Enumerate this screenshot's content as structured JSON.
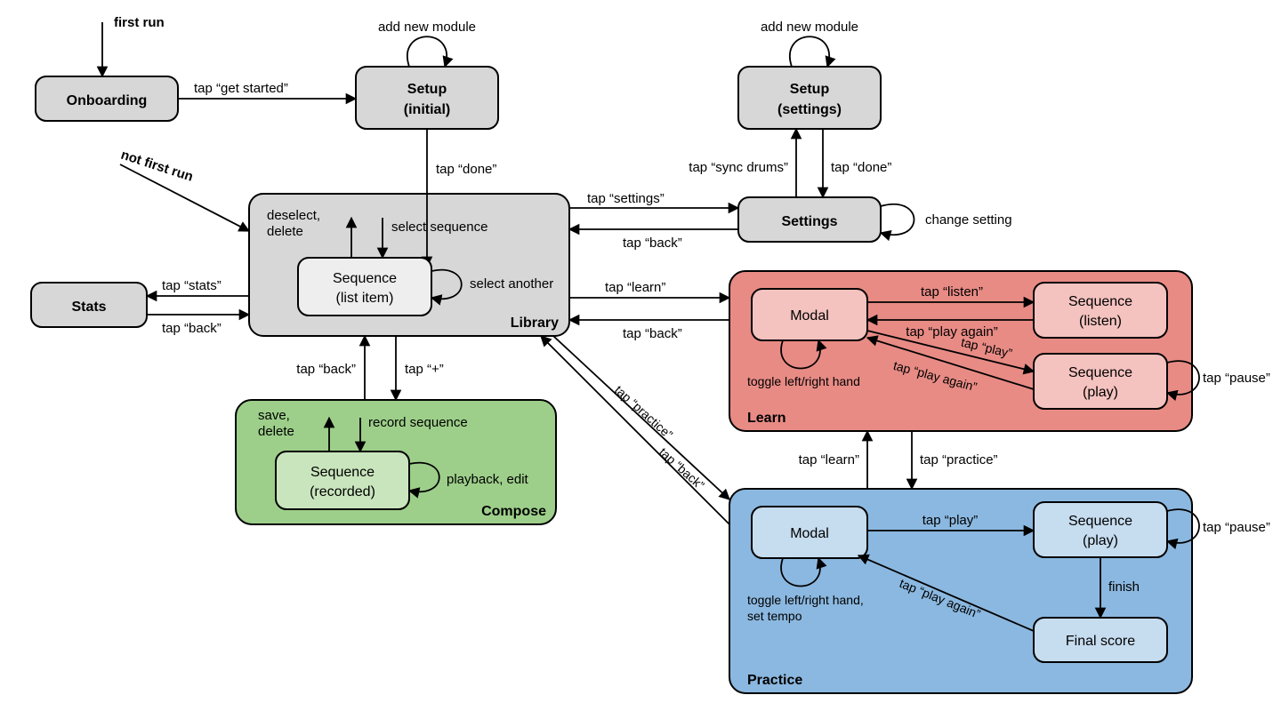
{
  "nodes": {
    "onboarding": "Onboarding",
    "setup_initial_l1": "Setup",
    "setup_initial_l2": "(initial)",
    "setup_settings_l1": "Setup",
    "setup_settings_l2": "(settings)",
    "settings": "Settings",
    "stats": "Stats",
    "library": "Library",
    "sequence_list_l1": "Sequence",
    "sequence_list_l2": "(list item)",
    "compose": "Compose",
    "sequence_rec_l1": "Sequence",
    "sequence_rec_l2": "(recorded)",
    "learn": "Learn",
    "learn_modal": "Modal",
    "learn_seq_listen_l1": "Sequence",
    "learn_seq_listen_l2": "(listen)",
    "learn_seq_play_l1": "Sequence",
    "learn_seq_play_l2": "(play)",
    "practice": "Practice",
    "practice_modal": "Modal",
    "practice_seq_play_l1": "Sequence",
    "practice_seq_play_l2": "(play)",
    "final_score": "Final score"
  },
  "edges": {
    "first_run": "first run",
    "not_first_run": "not first run",
    "tap_get_started": "tap “get started”",
    "add_new_module_1": "add new module",
    "add_new_module_2": "add new module",
    "tap_done_1": "tap “done”",
    "tap_done_2": "tap “done”",
    "tap_sync_drums": "tap “sync drums”",
    "tap_settings": "tap “settings”",
    "tap_back_settings": "tap “back”",
    "change_setting": "change setting",
    "deselect_delete": "deselect,\ndelete",
    "select_sequence": "select sequence",
    "select_another": "select another",
    "tap_stats": "tap “stats”",
    "tap_back_stats": "tap “back”",
    "tap_back_compose": "tap “back”",
    "tap_plus": "tap “+”",
    "save_delete": "save,\ndelete",
    "record_sequence": "record sequence",
    "playback_edit": "playback, edit",
    "tap_learn": "tap “learn”",
    "tap_back_learn": "tap “back”",
    "tap_practice": "tap “practice”",
    "tap_back_practice": "tap “back”",
    "tap_listen": "tap “listen”",
    "tap_play_again_listen": "tap “play again”",
    "tap_play_learn": "tap “play”",
    "tap_play_again_play": "tap “play again”",
    "tap_pause_learn": "tap “pause”",
    "toggle_hand": "toggle left/right hand",
    "tap_learn_2": "tap “learn”",
    "tap_practice_2": "tap “practice”",
    "tap_play_practice": "tap “play”",
    "finish": "finish",
    "tap_play_again_final": "tap “play again”",
    "tap_pause_practice": "tap “pause”",
    "toggle_hand_tempo_l1": "toggle left/right hand,",
    "toggle_hand_tempo_l2": "set tempo"
  }
}
